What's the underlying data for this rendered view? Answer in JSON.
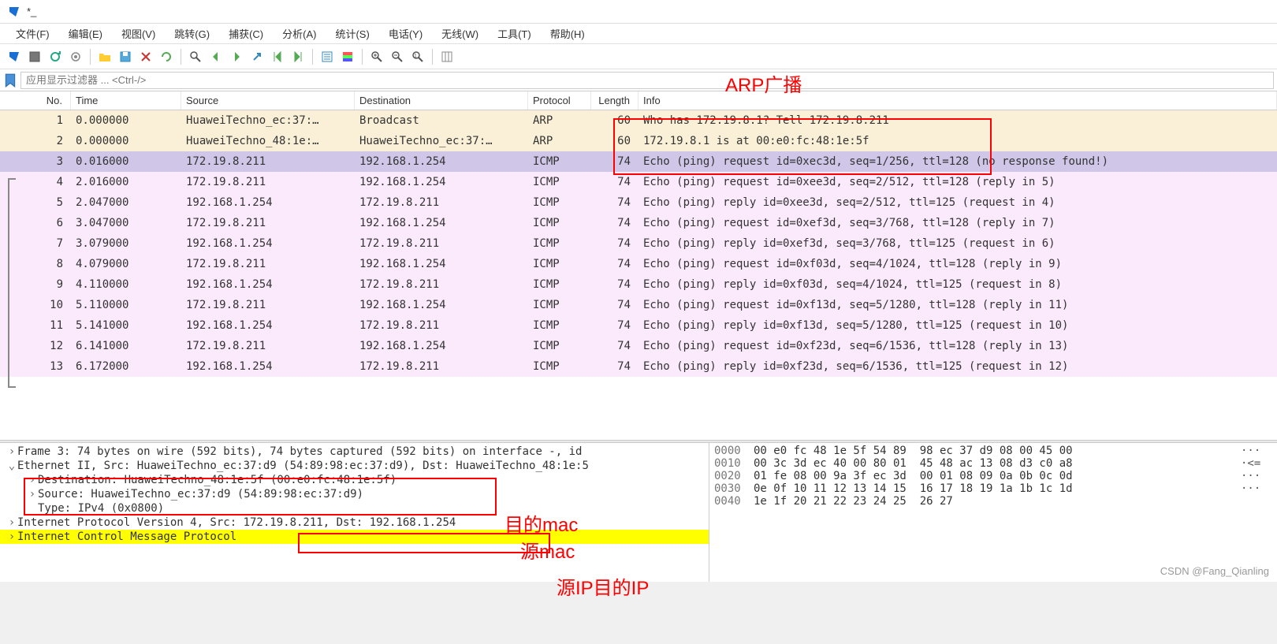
{
  "window": {
    "title": "*_"
  },
  "menu": [
    "文件(F)",
    "编辑(E)",
    "视图(V)",
    "跳转(G)",
    "捕获(C)",
    "分析(A)",
    "统计(S)",
    "电话(Y)",
    "无线(W)",
    "工具(T)",
    "帮助(H)"
  ],
  "filter": {
    "placeholder": "应用显示过滤器 ... <Ctrl-/>"
  },
  "columns": {
    "no": "No.",
    "time": "Time",
    "source": "Source",
    "destination": "Destination",
    "protocol": "Protocol",
    "length": "Length",
    "info": "Info"
  },
  "annotations": {
    "arp": "ARP广播",
    "dst_mac": "目的mac",
    "src_mac": "源mac",
    "ips": "源IP目的IP"
  },
  "packets": [
    {
      "no": "1",
      "time": "0.000000",
      "src": "HuaweiTechno_ec:37:…",
      "dst": "Broadcast",
      "proto": "ARP",
      "len": "60",
      "info": "Who has 172.19.8.1? Tell 172.19.8.211",
      "cls": "arp-row"
    },
    {
      "no": "2",
      "time": "0.000000",
      "src": "HuaweiTechno_48:1e:…",
      "dst": "HuaweiTechno_ec:37:…",
      "proto": "ARP",
      "len": "60",
      "info": "172.19.8.1 is at 00:e0:fc:48:1e:5f",
      "cls": "arp-row"
    },
    {
      "no": "3",
      "time": "0.016000",
      "src": "172.19.8.211",
      "dst": "192.168.1.254",
      "proto": "ICMP",
      "len": "74",
      "info": "Echo (ping) request  id=0xec3d, seq=1/256, ttl=128 (no response found!)",
      "cls": "selected-row"
    },
    {
      "no": "4",
      "time": "2.016000",
      "src": "172.19.8.211",
      "dst": "192.168.1.254",
      "proto": "ICMP",
      "len": "74",
      "info": "Echo (ping) request  id=0xee3d, seq=2/512, ttl=128 (reply in 5)",
      "cls": "icmp-row"
    },
    {
      "no": "5",
      "time": "2.047000",
      "src": "192.168.1.254",
      "dst": "172.19.8.211",
      "proto": "ICMP",
      "len": "74",
      "info": "Echo (ping) reply    id=0xee3d, seq=2/512, ttl=125 (request in 4)",
      "cls": "icmp-row"
    },
    {
      "no": "6",
      "time": "3.047000",
      "src": "172.19.8.211",
      "dst": "192.168.1.254",
      "proto": "ICMP",
      "len": "74",
      "info": "Echo (ping) request  id=0xef3d, seq=3/768, ttl=128 (reply in 7)",
      "cls": "icmp-row"
    },
    {
      "no": "7",
      "time": "3.079000",
      "src": "192.168.1.254",
      "dst": "172.19.8.211",
      "proto": "ICMP",
      "len": "74",
      "info": "Echo (ping) reply    id=0xef3d, seq=3/768, ttl=125 (request in 6)",
      "cls": "icmp-row"
    },
    {
      "no": "8",
      "time": "4.079000",
      "src": "172.19.8.211",
      "dst": "192.168.1.254",
      "proto": "ICMP",
      "len": "74",
      "info": "Echo (ping) request  id=0xf03d, seq=4/1024, ttl=128 (reply in 9)",
      "cls": "icmp-row"
    },
    {
      "no": "9",
      "time": "4.110000",
      "src": "192.168.1.254",
      "dst": "172.19.8.211",
      "proto": "ICMP",
      "len": "74",
      "info": "Echo (ping) reply    id=0xf03d, seq=4/1024, ttl=125 (request in 8)",
      "cls": "icmp-row"
    },
    {
      "no": "10",
      "time": "5.110000",
      "src": "172.19.8.211",
      "dst": "192.168.1.254",
      "proto": "ICMP",
      "len": "74",
      "info": "Echo (ping) request  id=0xf13d, seq=5/1280, ttl=128 (reply in 11)",
      "cls": "icmp-row"
    },
    {
      "no": "11",
      "time": "5.141000",
      "src": "192.168.1.254",
      "dst": "172.19.8.211",
      "proto": "ICMP",
      "len": "74",
      "info": "Echo (ping) reply    id=0xf13d, seq=5/1280, ttl=125 (request in 10)",
      "cls": "icmp-row"
    },
    {
      "no": "12",
      "time": "6.141000",
      "src": "172.19.8.211",
      "dst": "192.168.1.254",
      "proto": "ICMP",
      "len": "74",
      "info": "Echo (ping) request  id=0xf23d, seq=6/1536, ttl=128 (reply in 13)",
      "cls": "icmp-row"
    },
    {
      "no": "13",
      "time": "6.172000",
      "src": "192.168.1.254",
      "dst": "172.19.8.211",
      "proto": "ICMP",
      "len": "74",
      "info": "Echo (ping) reply    id=0xf23d, seq=6/1536, ttl=125 (request in 12)",
      "cls": "icmp-row"
    }
  ],
  "details": {
    "frame": "Frame 3: 74 bytes on wire (592 bits), 74 bytes captured (592 bits) on interface -, id",
    "eth": "Ethernet II, Src: HuaweiTechno_ec:37:d9 (54:89:98:ec:37:d9), Dst: HuaweiTechno_48:1e:5",
    "eth_dst": "Destination: HuaweiTechno_48:1e:5f (00:e0:fc:48:1e:5f)",
    "eth_src": "Source: HuaweiTechno_ec:37:d9 (54:89:98:ec:37:d9)",
    "eth_type": "Type: IPv4 (0x0800)",
    "ip_prefix": "Internet Protocol Version 4, Src: ",
    "ip_boxed": "172.19.8.211, Dst: 192.168.1.254",
    "icmp": "Internet Control Message Protocol"
  },
  "hex": [
    {
      "offset": "0000",
      "bytes": "00 e0 fc 48 1e 5f 54 89  98 ec 37 d9 08 00 45 00",
      "ascii": "···"
    },
    {
      "offset": "0010",
      "bytes": "00 3c 3d ec 40 00 80 01  45 48 ac 13 08 d3 c0 a8",
      "ascii": "·<="
    },
    {
      "offset": "0020",
      "bytes": "01 fe 08 00 9a 3f ec 3d  00 01 08 09 0a 0b 0c 0d",
      "ascii": "···"
    },
    {
      "offset": "0030",
      "bytes": "0e 0f 10 11 12 13 14 15  16 17 18 19 1a 1b 1c 1d",
      "ascii": "···"
    },
    {
      "offset": "0040",
      "bytes": "1e 1f 20 21 22 23 24 25  26 27",
      "ascii": ""
    }
  ],
  "watermark": "CSDN @Fang_Qianling"
}
